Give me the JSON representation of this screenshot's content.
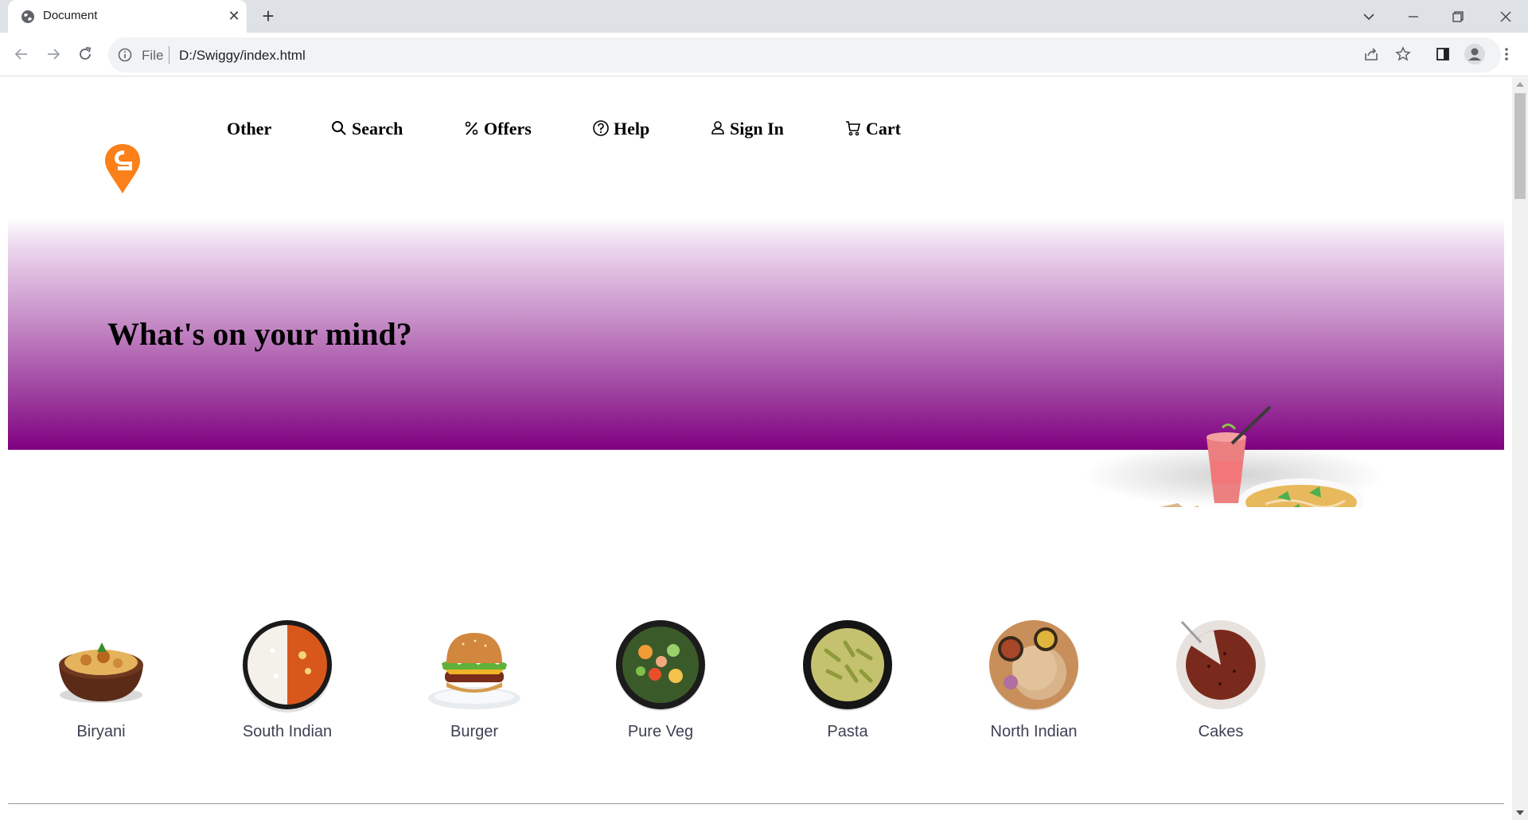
{
  "browser": {
    "tab_title": "Document",
    "url_scheme": "File",
    "url": "D:/Swiggy/index.html"
  },
  "nav": {
    "items": [
      {
        "label": "Other",
        "icon": ""
      },
      {
        "label": "Search",
        "icon": "search-icon"
      },
      {
        "label": "Offers",
        "icon": "percent-icon"
      },
      {
        "label": "Help",
        "icon": "help-icon"
      },
      {
        "label": "Sign In",
        "icon": "user-icon"
      },
      {
        "label": "Cart",
        "icon": "cart-icon"
      }
    ]
  },
  "hero": {
    "title": "What's on your mind?",
    "gradient_from": "#ffffff",
    "gradient_to": "#800080"
  },
  "categories": [
    {
      "label": "Biryani"
    },
    {
      "label": "South Indian"
    },
    {
      "label": "Burger"
    },
    {
      "label": "Pure Veg"
    },
    {
      "label": "Pasta"
    },
    {
      "label": "North Indian"
    },
    {
      "label": "Cakes"
    }
  ],
  "colors": {
    "brand": "#fc8019",
    "text": "#3d4152"
  }
}
